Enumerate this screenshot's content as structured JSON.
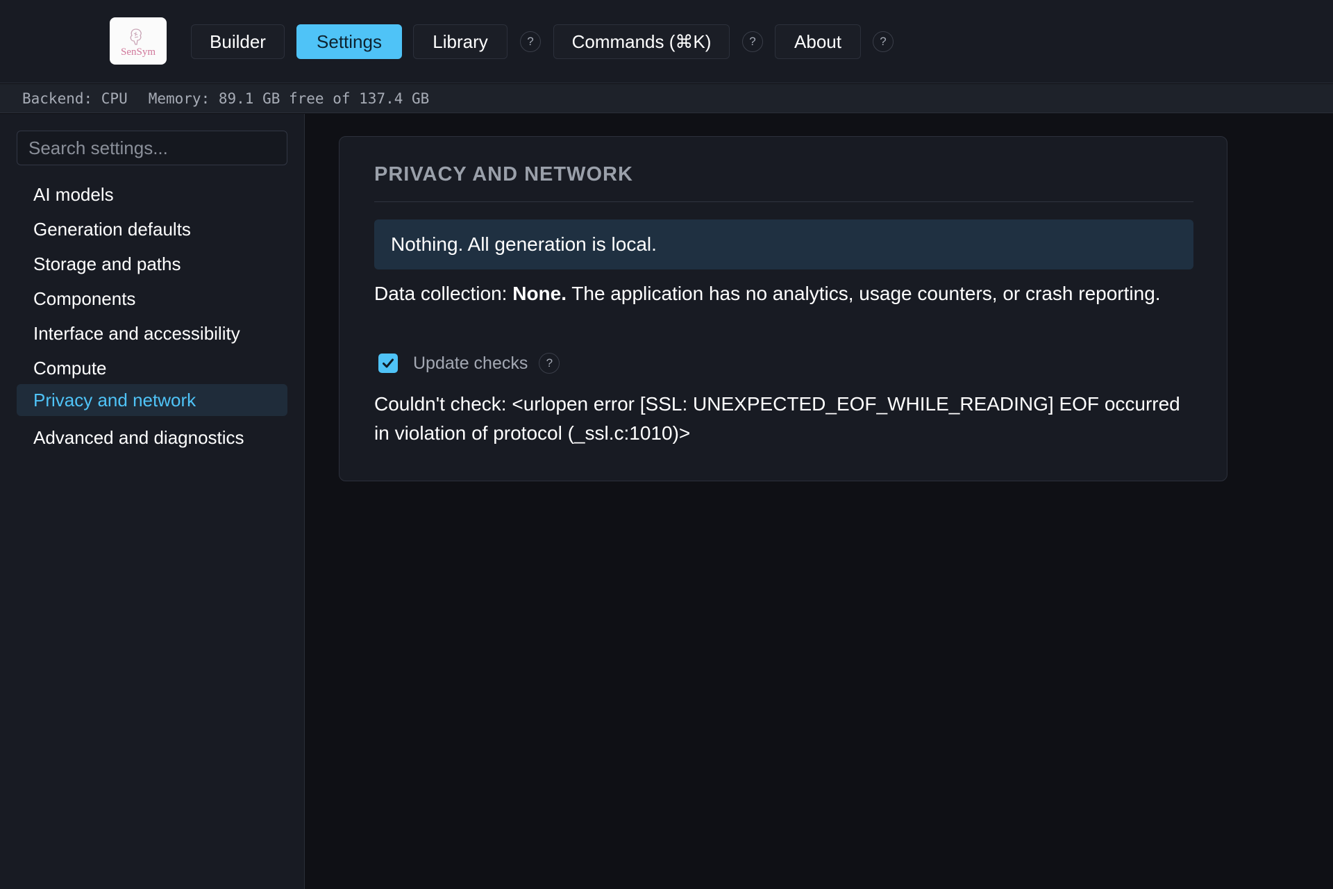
{
  "app": {
    "logo_text": "SenSym"
  },
  "topnav": {
    "builder": "Builder",
    "settings": "Settings",
    "library": "Library",
    "commands": "Commands (⌘K)",
    "about": "About",
    "help_glyph": "?"
  },
  "status": {
    "backend": "Backend: CPU",
    "memory": "Memory: 89.1 GB free of 137.4 GB"
  },
  "sidebar": {
    "search_placeholder": "Search settings...",
    "items": [
      {
        "label": "AI models",
        "active": false
      },
      {
        "label": "Generation defaults",
        "active": false
      },
      {
        "label": "Storage and paths",
        "active": false
      },
      {
        "label": "Components",
        "active": false
      },
      {
        "label": "Interface and accessibility",
        "active": false
      },
      {
        "label": "Compute",
        "active": false
      },
      {
        "label": "Privacy and network",
        "active": true
      },
      {
        "label": "Advanced and diagnostics",
        "active": false
      }
    ]
  },
  "panel": {
    "title": "PRIVACY AND NETWORK",
    "info": "Nothing. All generation is local.",
    "data_collection_label": "Data collection:",
    "data_collection_value": "None.",
    "data_collection_text": "The application has no analytics, usage counters, or crash reporting.",
    "update_checks_label": "Update checks",
    "update_checks_checked": true,
    "error_text": "Couldn't check: <urlopen error [SSL: UNEXPECTED_EOF_WHILE_READING] EOF occurred in violation of protocol (_ssl.c:1010)>"
  },
  "colors": {
    "accent": "#4fc3f7",
    "background": "#0f1015",
    "panel": "#181b23",
    "info_box": "#1f3041"
  }
}
